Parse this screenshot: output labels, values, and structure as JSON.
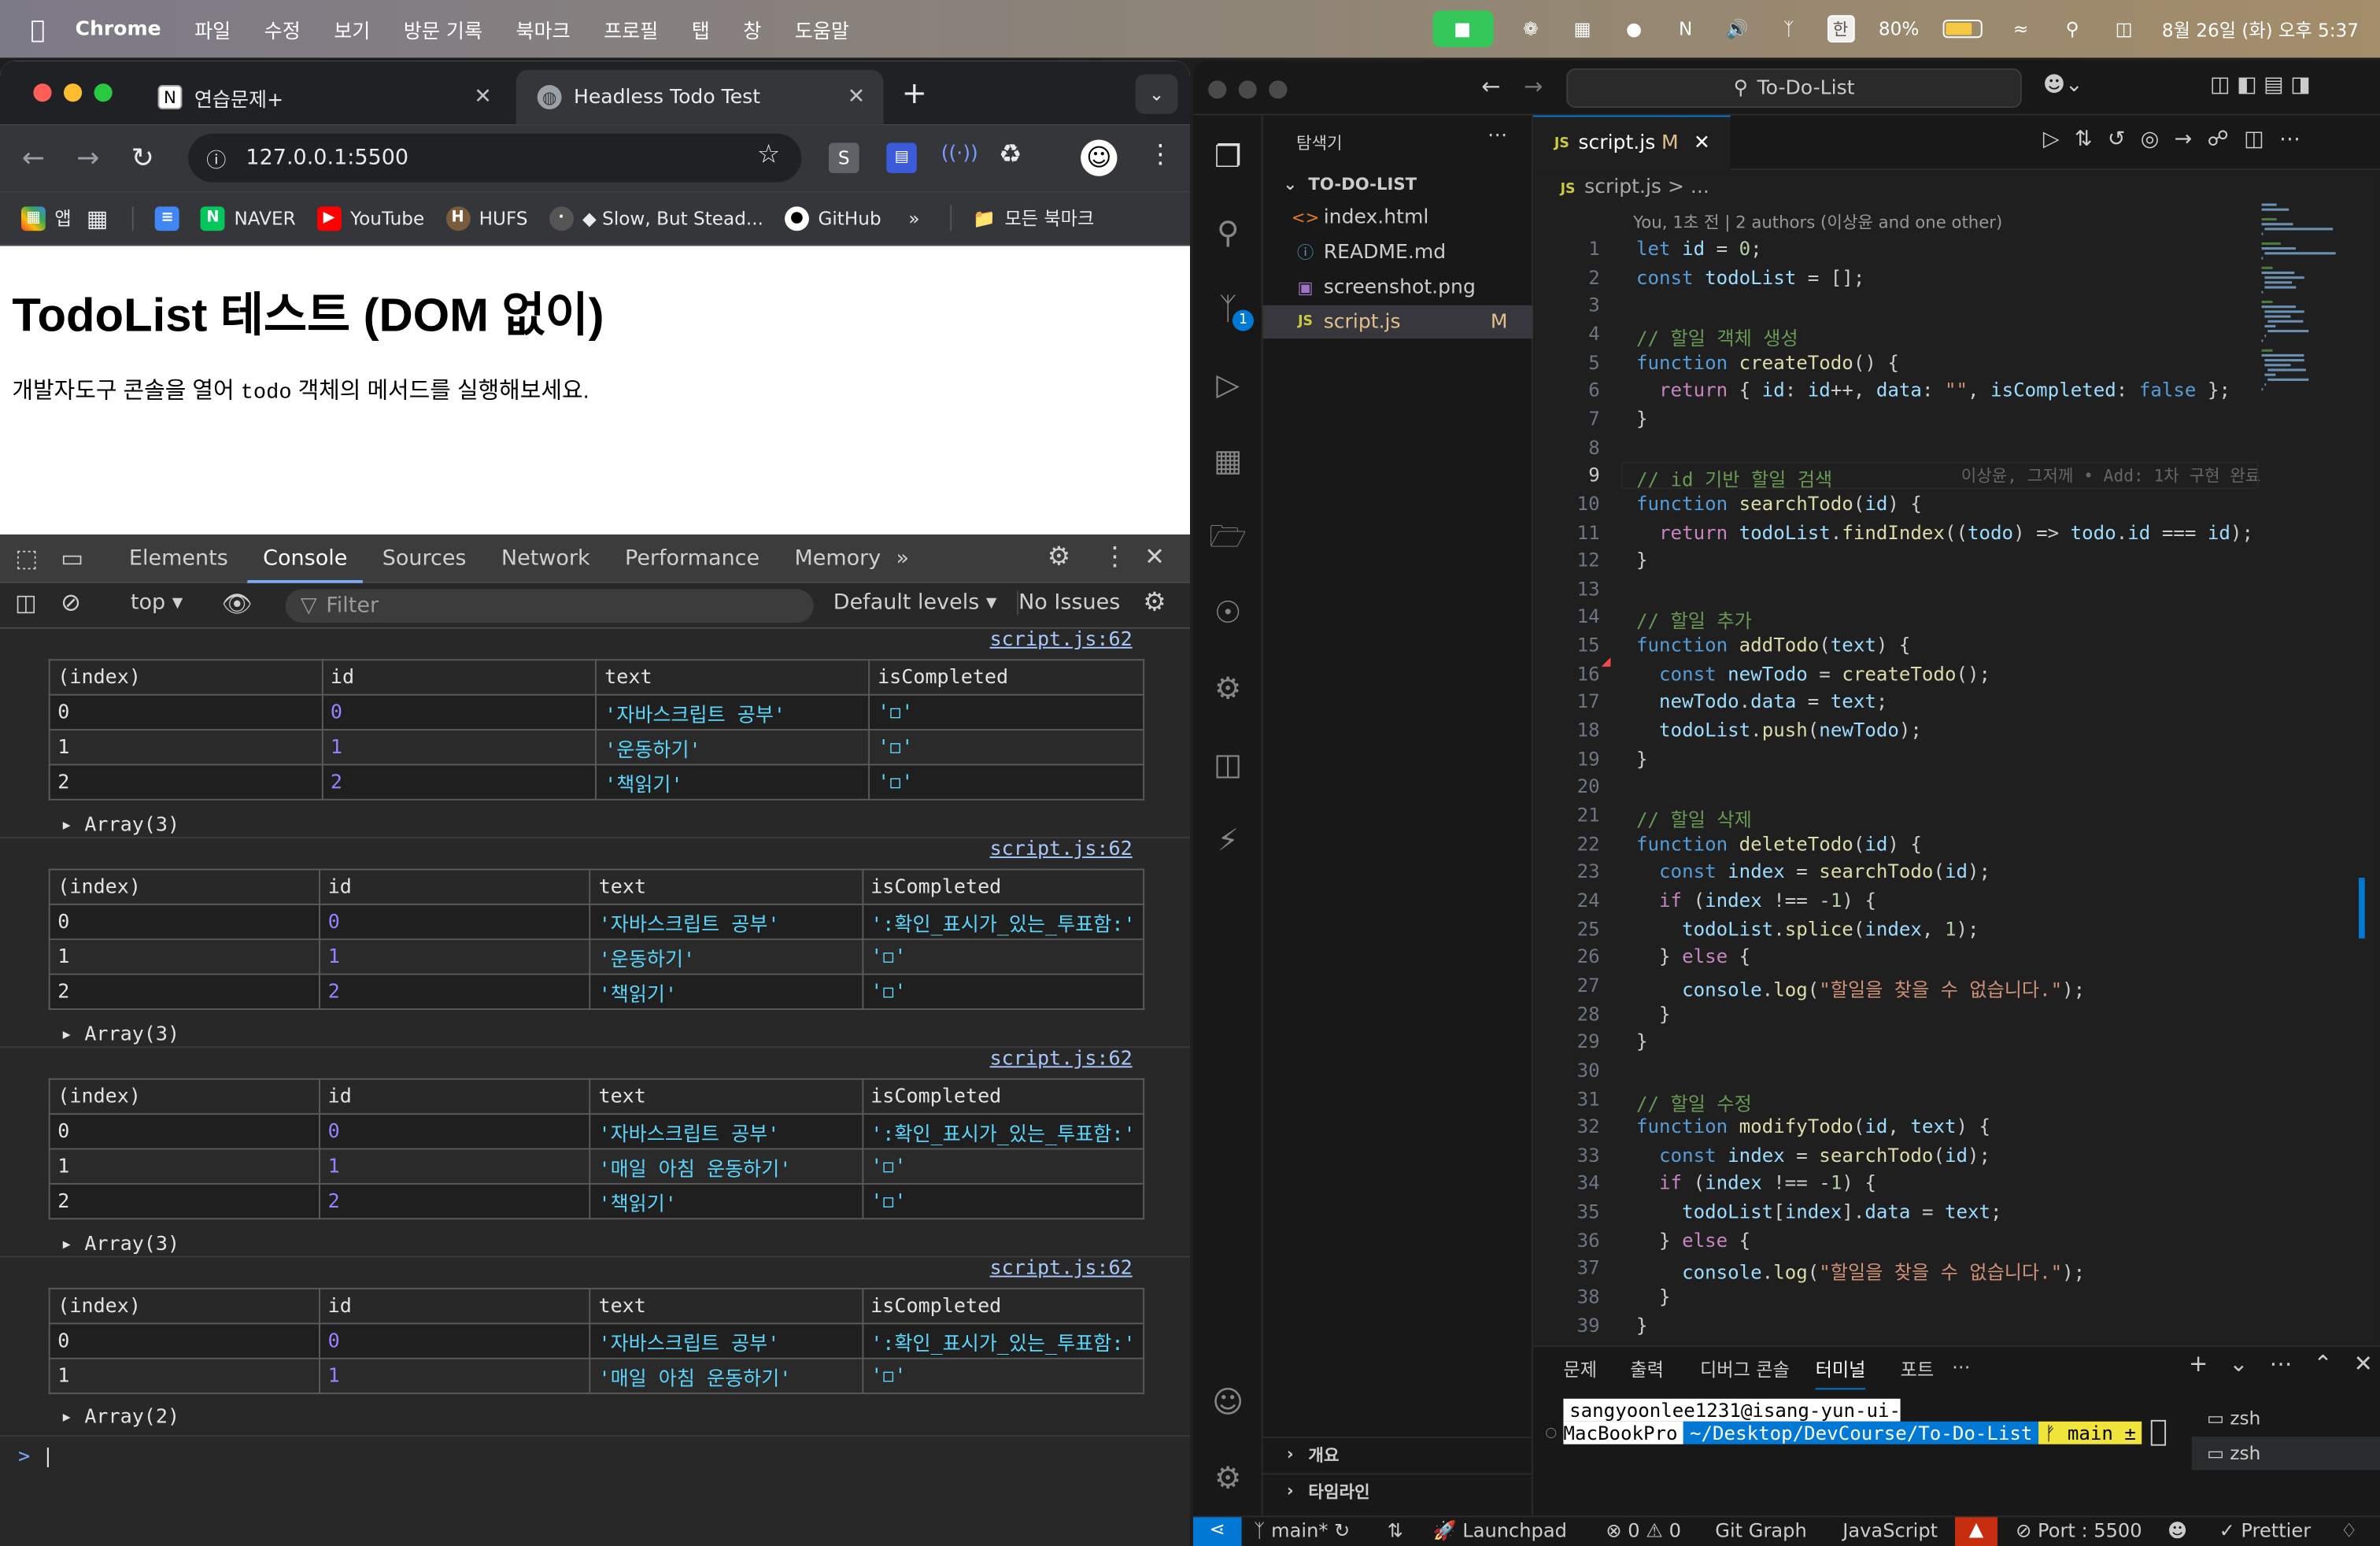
{
  "menubar": {
    "app": "Chrome",
    "items": [
      "파일",
      "수정",
      "보기",
      "방문 기록",
      "북마크",
      "프로필",
      "탭",
      "창",
      "도움말"
    ],
    "battery": "80%",
    "datetime": "8월 26일 (화) 오후 5:37",
    "input": "한"
  },
  "chrome": {
    "tabs": [
      {
        "label": "연습문제+"
      },
      {
        "label": "Headless Todo Test"
      }
    ],
    "url": "127.0.0.1:5500",
    "bookmarks": [
      {
        "label": "앱"
      },
      {
        "label": "NAVER"
      },
      {
        "label": "YouTube"
      },
      {
        "label": "HUFS"
      },
      {
        "label": "◆ Slow, But Stead..."
      },
      {
        "label": "GitHub"
      },
      {
        "label": "모든 북마크"
      }
    ]
  },
  "page": {
    "title": "TodoList 테스트 (DOM 없이)",
    "desc_before": "개발자도구 콘솔을 열어 ",
    "desc_code": "todo",
    "desc_after": " 객체의 메서드를 실행해보세요."
  },
  "devtools": {
    "tabs": [
      "Elements",
      "Console",
      "Sources",
      "Network",
      "Performance",
      "Memory"
    ],
    "context": "top",
    "filter_placeholder": "Filter",
    "levels": "Default levels",
    "issues": "No Issues"
  },
  "console": {
    "groups": [
      {
        "source": "script.js:62",
        "headers": [
          "(index)",
          "id",
          "text",
          "isCompleted"
        ],
        "rows": [
          [
            "0",
            "0",
            "'자바스크립트 공부'",
            "'◻︎'"
          ],
          [
            "1",
            "1",
            "'운동하기'",
            "'◻︎'"
          ],
          [
            "2",
            "2",
            "'책읽기'",
            "'◻︎'"
          ]
        ],
        "summary": "Array(3)"
      },
      {
        "source": "script.js:62",
        "headers": [
          "(index)",
          "id",
          "text",
          "isCompleted"
        ],
        "rows": [
          [
            "0",
            "0",
            "'자바스크립트 공부'",
            "':확인_표시가_있는_투표함:'"
          ],
          [
            "1",
            "1",
            "'운동하기'",
            "'◻︎'"
          ],
          [
            "2",
            "2",
            "'책읽기'",
            "'◻︎'"
          ]
        ],
        "summary": "Array(3)"
      },
      {
        "source": "script.js:62",
        "headers": [
          "(index)",
          "id",
          "text",
          "isCompleted"
        ],
        "rows": [
          [
            "0",
            "0",
            "'자바스크립트 공부'",
            "':확인_표시가_있는_투표함:'"
          ],
          [
            "1",
            "1",
            "'매일 아침 운동하기'",
            "'◻︎'"
          ],
          [
            "2",
            "2",
            "'책읽기'",
            "'◻︎'"
          ]
        ],
        "summary": "Array(3)"
      },
      {
        "source": "script.js:62",
        "headers": [
          "(index)",
          "id",
          "text",
          "isCompleted"
        ],
        "rows": [
          [
            "0",
            "0",
            "'자바스크립트 공부'",
            "':확인_표시가_있는_투표함:'"
          ],
          [
            "1",
            "1",
            "'매일 아침 운동하기'",
            "'◻︎'"
          ]
        ],
        "summary": "Array(2)"
      }
    ]
  },
  "vscode": {
    "search": "To-Do-List",
    "explorer_title": "탐색기",
    "folder": "TO-DO-LIST",
    "files": [
      {
        "name": "index.html",
        "icon": "<>"
      },
      {
        "name": "README.md",
        "icon": "ⓘ"
      },
      {
        "name": "screenshot.png",
        "icon": "▣"
      },
      {
        "name": "script.js",
        "icon": "JS",
        "badge": "M"
      }
    ],
    "outline": "개요",
    "timeline": "타임라인",
    "tab": {
      "label": "script.js",
      "badge": "M"
    },
    "breadcrumb": "script.js > ...",
    "blame": "You, 1초 전 | 2 authors (이상윤 and one other)",
    "inline_blame": "이상윤, 그저께 • Add: 1차 구현 완료",
    "panel_tabs": [
      "문제",
      "출력",
      "디버그 콘솔",
      "터미널",
      "포트"
    ],
    "terminal": {
      "user": "sangyoonlee1231@isang-yun-ui-MacBookPro",
      "path": "~/Desktop/DevCourse/To-Do-List",
      "branch": "ᚠ main ±"
    },
    "shells": [
      "zsh",
      "zsh"
    ],
    "status": {
      "branch": "main*",
      "launchpad": "Launchpad",
      "errors": "0",
      "warnings": "0",
      "gitgraph": "Git Graph",
      "lang": "JavaScript",
      "port": "Port : 5500",
      "prettier": "✓ Prettier"
    }
  },
  "code": [
    "let id = 0;",
    "const todoList = [];",
    "",
    "// 할일 객체 생성",
    "function createTodo() {",
    "  return { id: id++, data: \"\", isCompleted: false };",
    "}",
    "",
    "// id 기반 할일 검색",
    "function searchTodo(id) {",
    "  return todoList.findIndex((todo) => todo.id === id);",
    "}",
    "",
    "// 할일 추가",
    "function addTodo(text) {",
    "  const newTodo = createTodo();",
    "  newTodo.data = text;",
    "  todoList.push(newTodo);",
    "}",
    "",
    "// 할일 삭제",
    "function deleteTodo(id) {",
    "  const index = searchTodo(id);",
    "  if (index !== -1) {",
    "    todoList.splice(index, 1);",
    "  } else {",
    "    console.log(\"할일을 찾을 수 없습니다.\");",
    "  }",
    "}",
    "",
    "// 할일 수정",
    "function modifyTodo(id, text) {",
    "  const index = searchTodo(id);",
    "  if (index !== -1) {",
    "    todoList[index].data = text;",
    "  } else {",
    "    console.log(\"할일을 찾을 수 없습니다.\");",
    "  }",
    "}"
  ]
}
